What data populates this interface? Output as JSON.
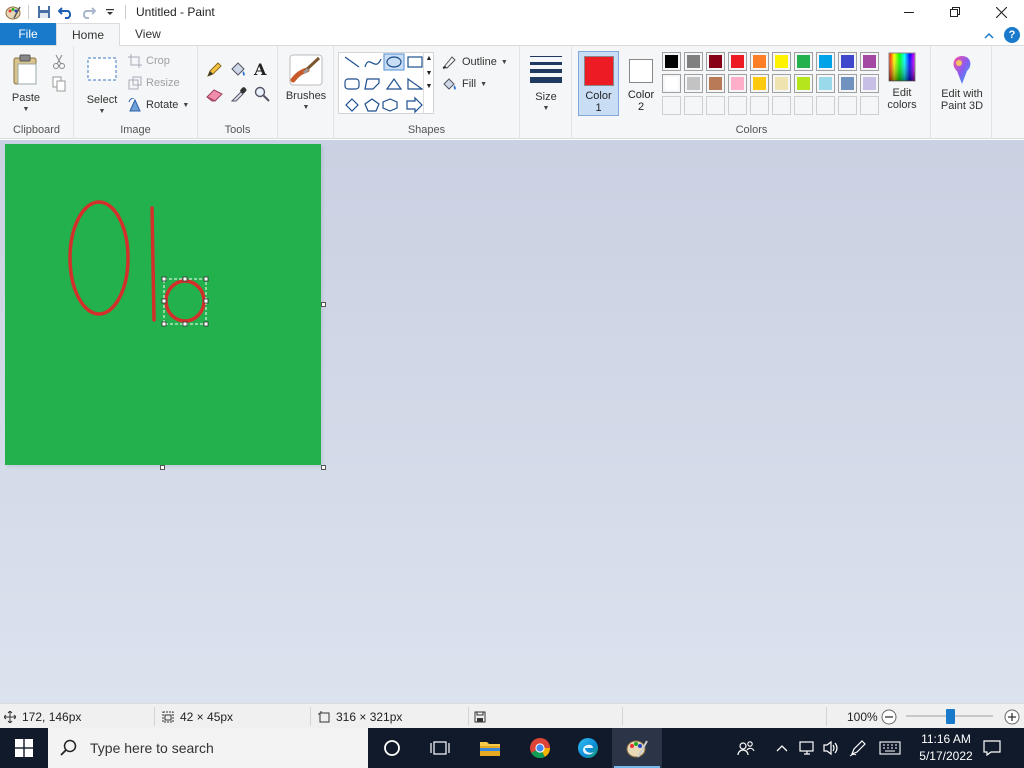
{
  "window": {
    "title": "Untitled - Paint"
  },
  "tabs": {
    "file": "File",
    "home": "Home",
    "view": "View"
  },
  "ribbon": {
    "clipboard": {
      "paste": "Paste",
      "group": "Clipboard"
    },
    "image": {
      "select": "Select",
      "crop": "Crop",
      "resize": "Resize",
      "rotate": "Rotate",
      "group": "Image"
    },
    "tools": {
      "group": "Tools"
    },
    "brushes": {
      "label": "Brushes"
    },
    "shapes": {
      "outline": "Outline",
      "fill": "Fill",
      "group": "Shapes"
    },
    "size": {
      "label": "Size"
    },
    "colors": {
      "color1": "Color\n1",
      "color1_line1": "Color",
      "color1_line2": "1",
      "color2_line1": "Color",
      "color2_line2": "2",
      "color1_value": "#ed1c24",
      "color2_value": "#ffffff",
      "edit_line1": "Edit",
      "edit_line2": "colors",
      "group": "Colors",
      "palette_row1": [
        "#000000",
        "#7f7f7f",
        "#880015",
        "#ed1c24",
        "#ff7f27",
        "#fff200",
        "#22b14c",
        "#00a2e8",
        "#3f48cc",
        "#a349a4"
      ],
      "palette_row2": [
        "#ffffff",
        "#c3c3c3",
        "#b97a57",
        "#ffaec9",
        "#ffc90e",
        "#efe4b0",
        "#b5e61d",
        "#99d9ea",
        "#7092be",
        "#c8bfe7"
      ]
    },
    "paint3d": {
      "line1": "Edit with",
      "line2": "Paint 3D"
    }
  },
  "canvas": {
    "background": "#22b14c",
    "stroke_color": "#d3302b"
  },
  "statusbar": {
    "cursor_pos": "172, 146px",
    "selection_size": "42 × 45px",
    "canvas_size": "316 × 321px",
    "zoom": "100%"
  },
  "taskbar": {
    "search_placeholder": "Type here to search",
    "time": "11:16 AM",
    "date": "5/17/2022"
  }
}
